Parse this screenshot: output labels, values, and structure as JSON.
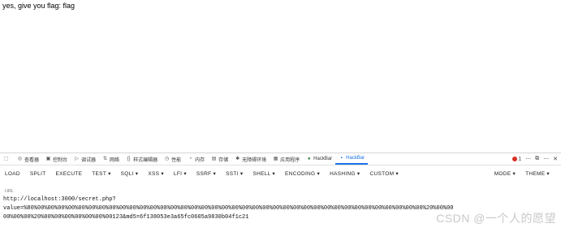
{
  "page": {
    "message": "yes, give you flag: flag"
  },
  "devtools": {
    "tabs": [
      {
        "label": "查看器",
        "icon": "inspector-icon"
      },
      {
        "label": "控制台",
        "icon": "console-icon"
      },
      {
        "label": "调试器",
        "icon": "debugger-icon"
      },
      {
        "label": "网络",
        "icon": "network-icon"
      },
      {
        "label": "样式编辑器",
        "icon": "style-editor-icon"
      },
      {
        "label": "性能",
        "icon": "performance-icon"
      },
      {
        "label": "内存",
        "icon": "memory-icon"
      },
      {
        "label": "存储",
        "icon": "storage-icon"
      },
      {
        "label": "无障碍环境",
        "icon": "accessibility-icon"
      },
      {
        "label": "应用程序",
        "icon": "application-icon"
      },
      {
        "label": "HackBar",
        "icon": "hackbar-icon"
      },
      {
        "label": "HackBar",
        "icon": "hackbar-icon"
      }
    ],
    "error_count": "1",
    "accent_color": "#1a73e8"
  },
  "hackbar": {
    "toolbar": [
      "LOAD",
      "SPLIT",
      "EXECUTE",
      "TEST ▾",
      "SQLI ▾",
      "XSS ▾",
      "LFI ▾",
      "SSRF ▾",
      "SSTI ▾",
      "SHELL ▾",
      "ENCODING ▾",
      "HASHING ▾",
      "CUSTOM ▾"
    ],
    "mode_label": "MODE ▾",
    "theme_label": "THEME ▾",
    "url_label": "URL",
    "url_lines": [
      "http://localhost:3000/secret.php?",
      "value=%80%00%00%00%00%00%00%00%00%00%00%00%00%00%00%00%00%00%00%00%00%00%00%00%00%00%00%00%00%00%00%00%00%00%00%00%00%00%00%20%00%00",
      "00%00%00%20%00%00%00%00%00%00%00123&md5=6f138053e3a65fc0605a9830b04f1c21"
    ]
  },
  "watermark": "CSDN @一个人的愿望"
}
